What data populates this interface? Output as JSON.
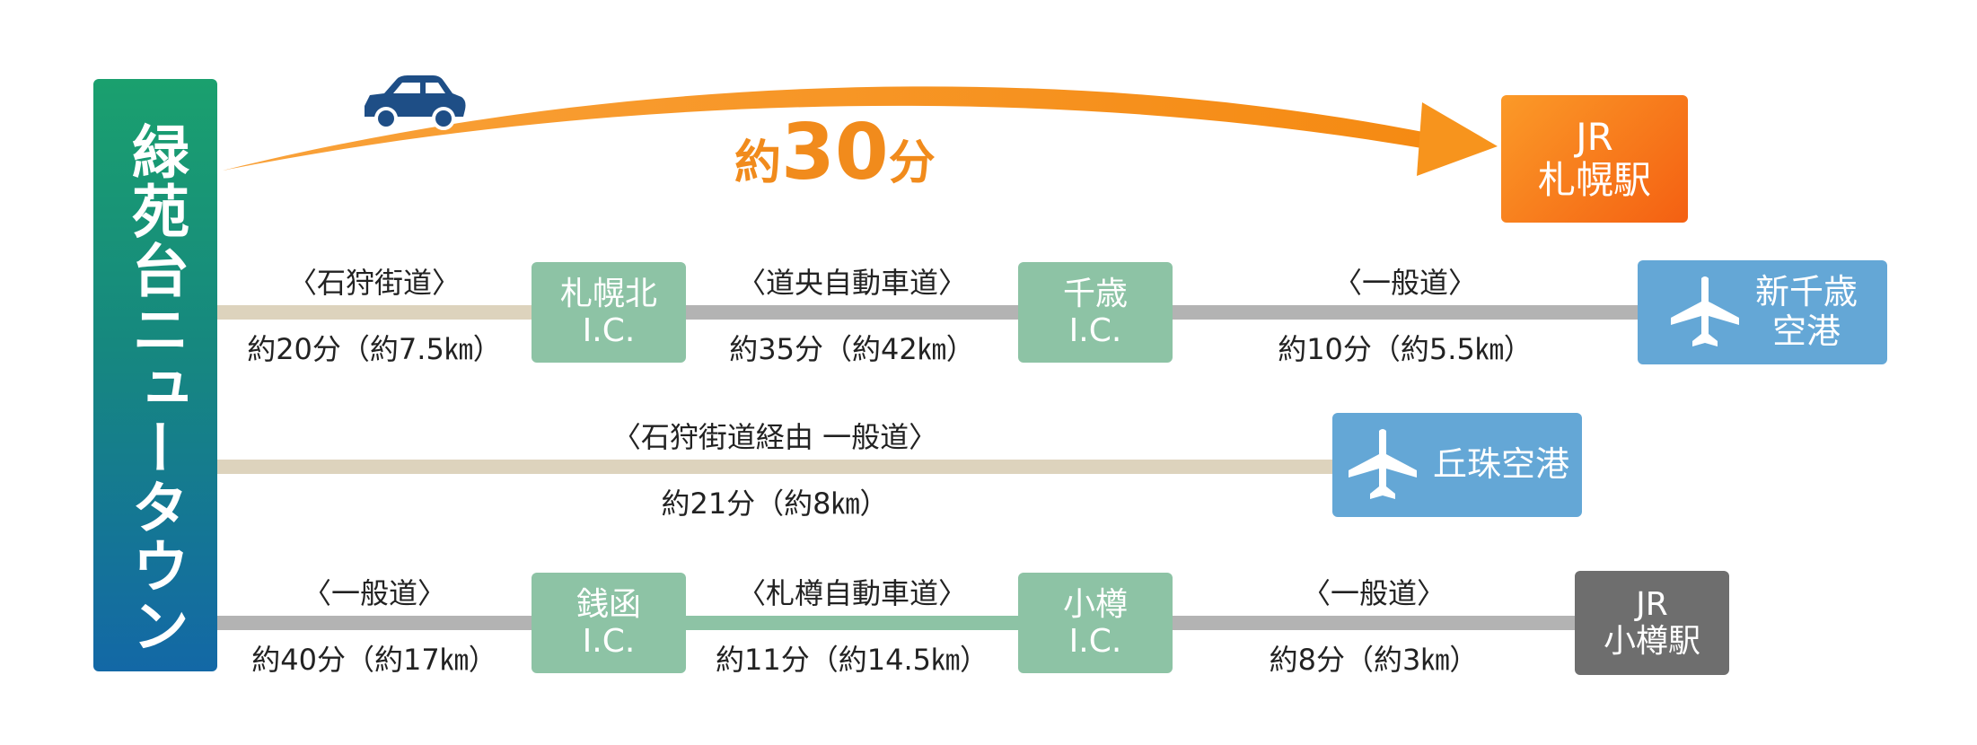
{
  "origin": {
    "name": "緑苑台ニュータウン"
  },
  "top_route": {
    "time_prefix": "約",
    "time_number": "30",
    "time_suffix": "分",
    "destination_line1": "JR",
    "destination_line2": "札幌駅",
    "vehicle_icon": "car-icon"
  },
  "route1": {
    "seg1": {
      "road": "〈石狩街道〉",
      "info": "約20分（約7.5㎞）"
    },
    "ic1": {
      "line1": "札幌北",
      "line2": "I.C."
    },
    "seg2": {
      "road": "〈道央自動車道〉",
      "info": "約35分（約42㎞）"
    },
    "ic2": {
      "line1": "千歳",
      "line2": "I.C."
    },
    "seg3": {
      "road": "〈一般道〉",
      "info": "約10分（約5.5㎞）"
    },
    "destination": {
      "line1": "新千歳",
      "line2": "空港",
      "icon": "airplane-icon"
    }
  },
  "route2": {
    "road": "〈石狩街道経由 一般道〉",
    "info": "約21分（約8㎞）",
    "destination": {
      "name": "丘珠空港",
      "icon": "airplane-icon"
    }
  },
  "route3": {
    "seg1": {
      "road": "〈一般道〉",
      "info": "約40分（約17㎞）"
    },
    "ic1": {
      "line1": "銭函",
      "line2": "I.C."
    },
    "seg2": {
      "road": "〈札樽自動車道〉",
      "info": "約11分（約14.5㎞）"
    },
    "ic2": {
      "line1": "小樽",
      "line2": "I.C."
    },
    "seg3": {
      "road": "〈一般道〉",
      "info": "約8分（約3㎞）"
    },
    "destination": {
      "line1": "JR",
      "line2": "小樽駅"
    }
  },
  "colors": {
    "origin_green": "#1aa06e",
    "origin_blue": "#1368a6",
    "arrow_orange": "#f7941d",
    "car_navy": "#1e4e86",
    "ic_green": "#8dc3a5",
    "airport_blue": "#64a7d6",
    "station_gray": "#6e6e6e",
    "road_beige": "#ddd3bd",
    "road_gray": "#b3b3b3"
  }
}
